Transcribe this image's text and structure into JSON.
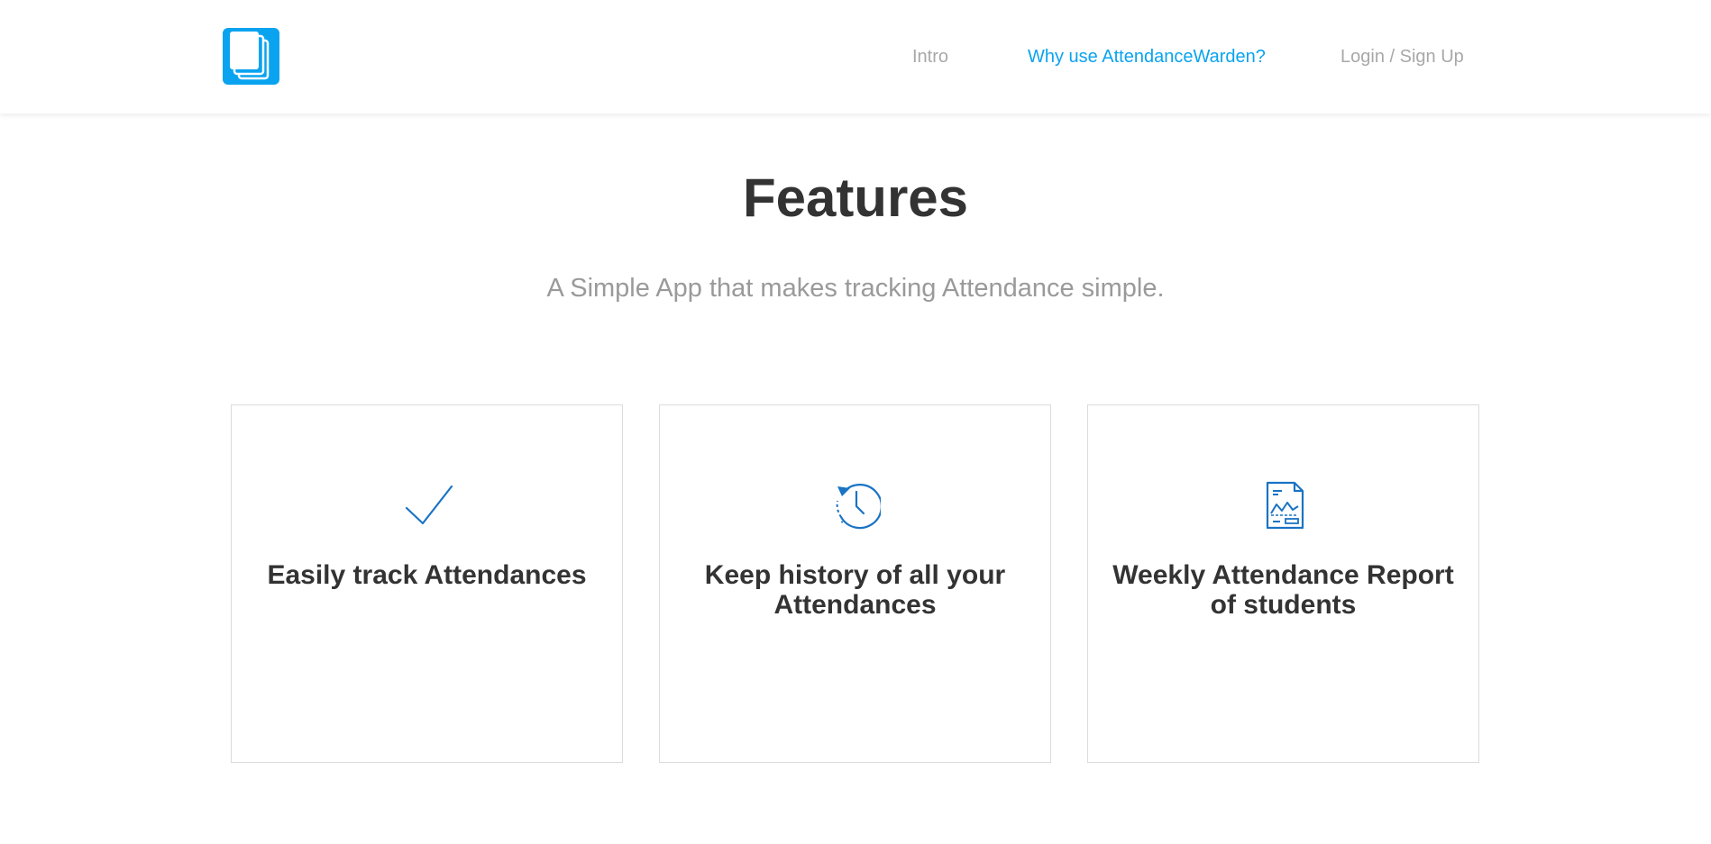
{
  "colors": {
    "accent": "#0aa3f0",
    "icon_blue": "#1a73c4",
    "heading": "#333333",
    "muted": "#a8a8a8"
  },
  "header": {
    "logo_icon": "stacked-documents-icon",
    "nav": {
      "intro": "Intro",
      "why": "Why use AttendanceWarden?",
      "login": "Login / Sign Up"
    }
  },
  "main": {
    "title": "Features",
    "subtitle": "A Simple App that makes tracking Attendance simple.",
    "features": [
      {
        "icon": "checkmark-icon",
        "title": "Easily track Attendances"
      },
      {
        "icon": "history-clock-icon",
        "title": "Keep history of all your Attendances"
      },
      {
        "icon": "report-document-icon",
        "title": "Weekly Attendance Report of students"
      }
    ]
  }
}
